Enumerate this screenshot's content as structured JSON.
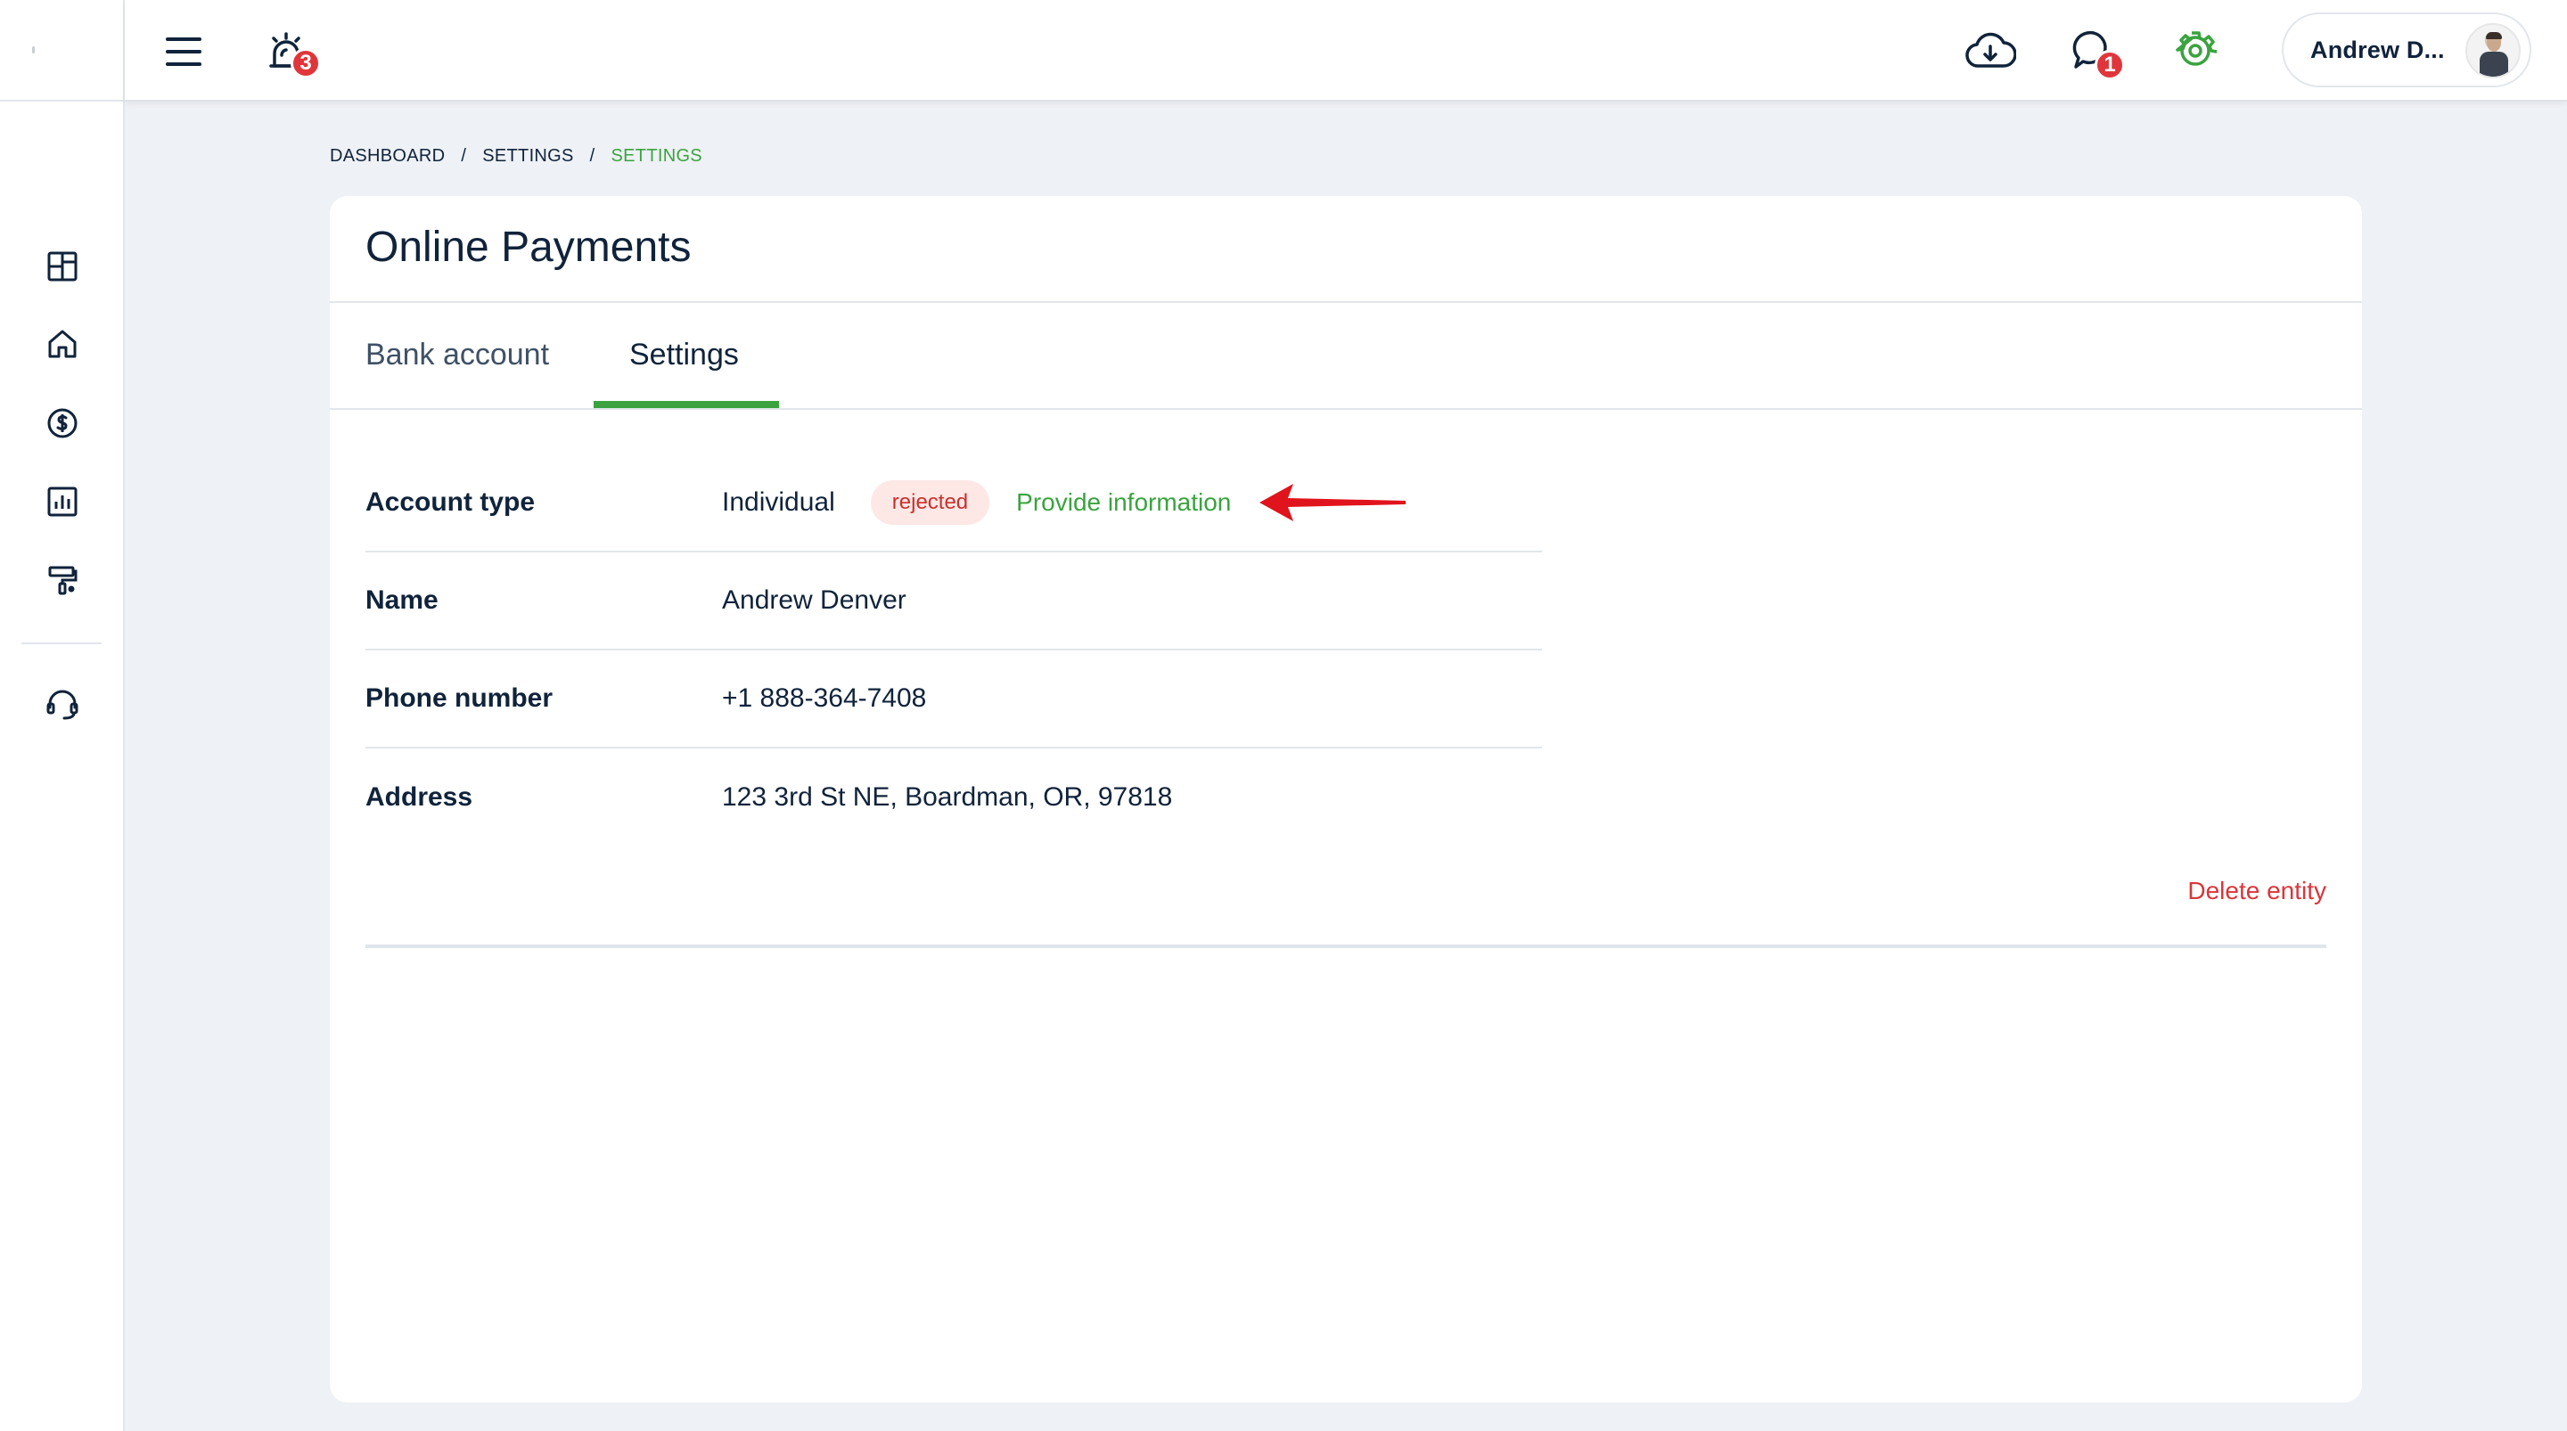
{
  "topbar": {
    "alerts_badge": "3",
    "messages_badge": "1",
    "user_name": "Andrew D..."
  },
  "breadcrumb": {
    "items": [
      "DASHBOARD",
      "SETTINGS",
      "SETTINGS"
    ],
    "separator": "/"
  },
  "page": {
    "title": "Online Payments",
    "tabs": [
      {
        "label": "Bank account",
        "active": false
      },
      {
        "label": "Settings",
        "active": true
      }
    ]
  },
  "details": {
    "account_type": {
      "label": "Account type",
      "value": "Individual",
      "status": "rejected",
      "action": "Provide information"
    },
    "name": {
      "label": "Name",
      "value": "Andrew Denver"
    },
    "phone": {
      "label": "Phone number",
      "value": "+1 888-364-7408"
    },
    "address": {
      "label": "Address",
      "value": "123 3rd St NE, Boardman, OR, 97818"
    }
  },
  "delete_label": "Delete entity",
  "colors": {
    "accent_green": "#3aa33f",
    "danger_red": "#d9363b",
    "badge_red": "#e0363b",
    "text_dark": "#10233b",
    "background": "#eef1f5"
  }
}
